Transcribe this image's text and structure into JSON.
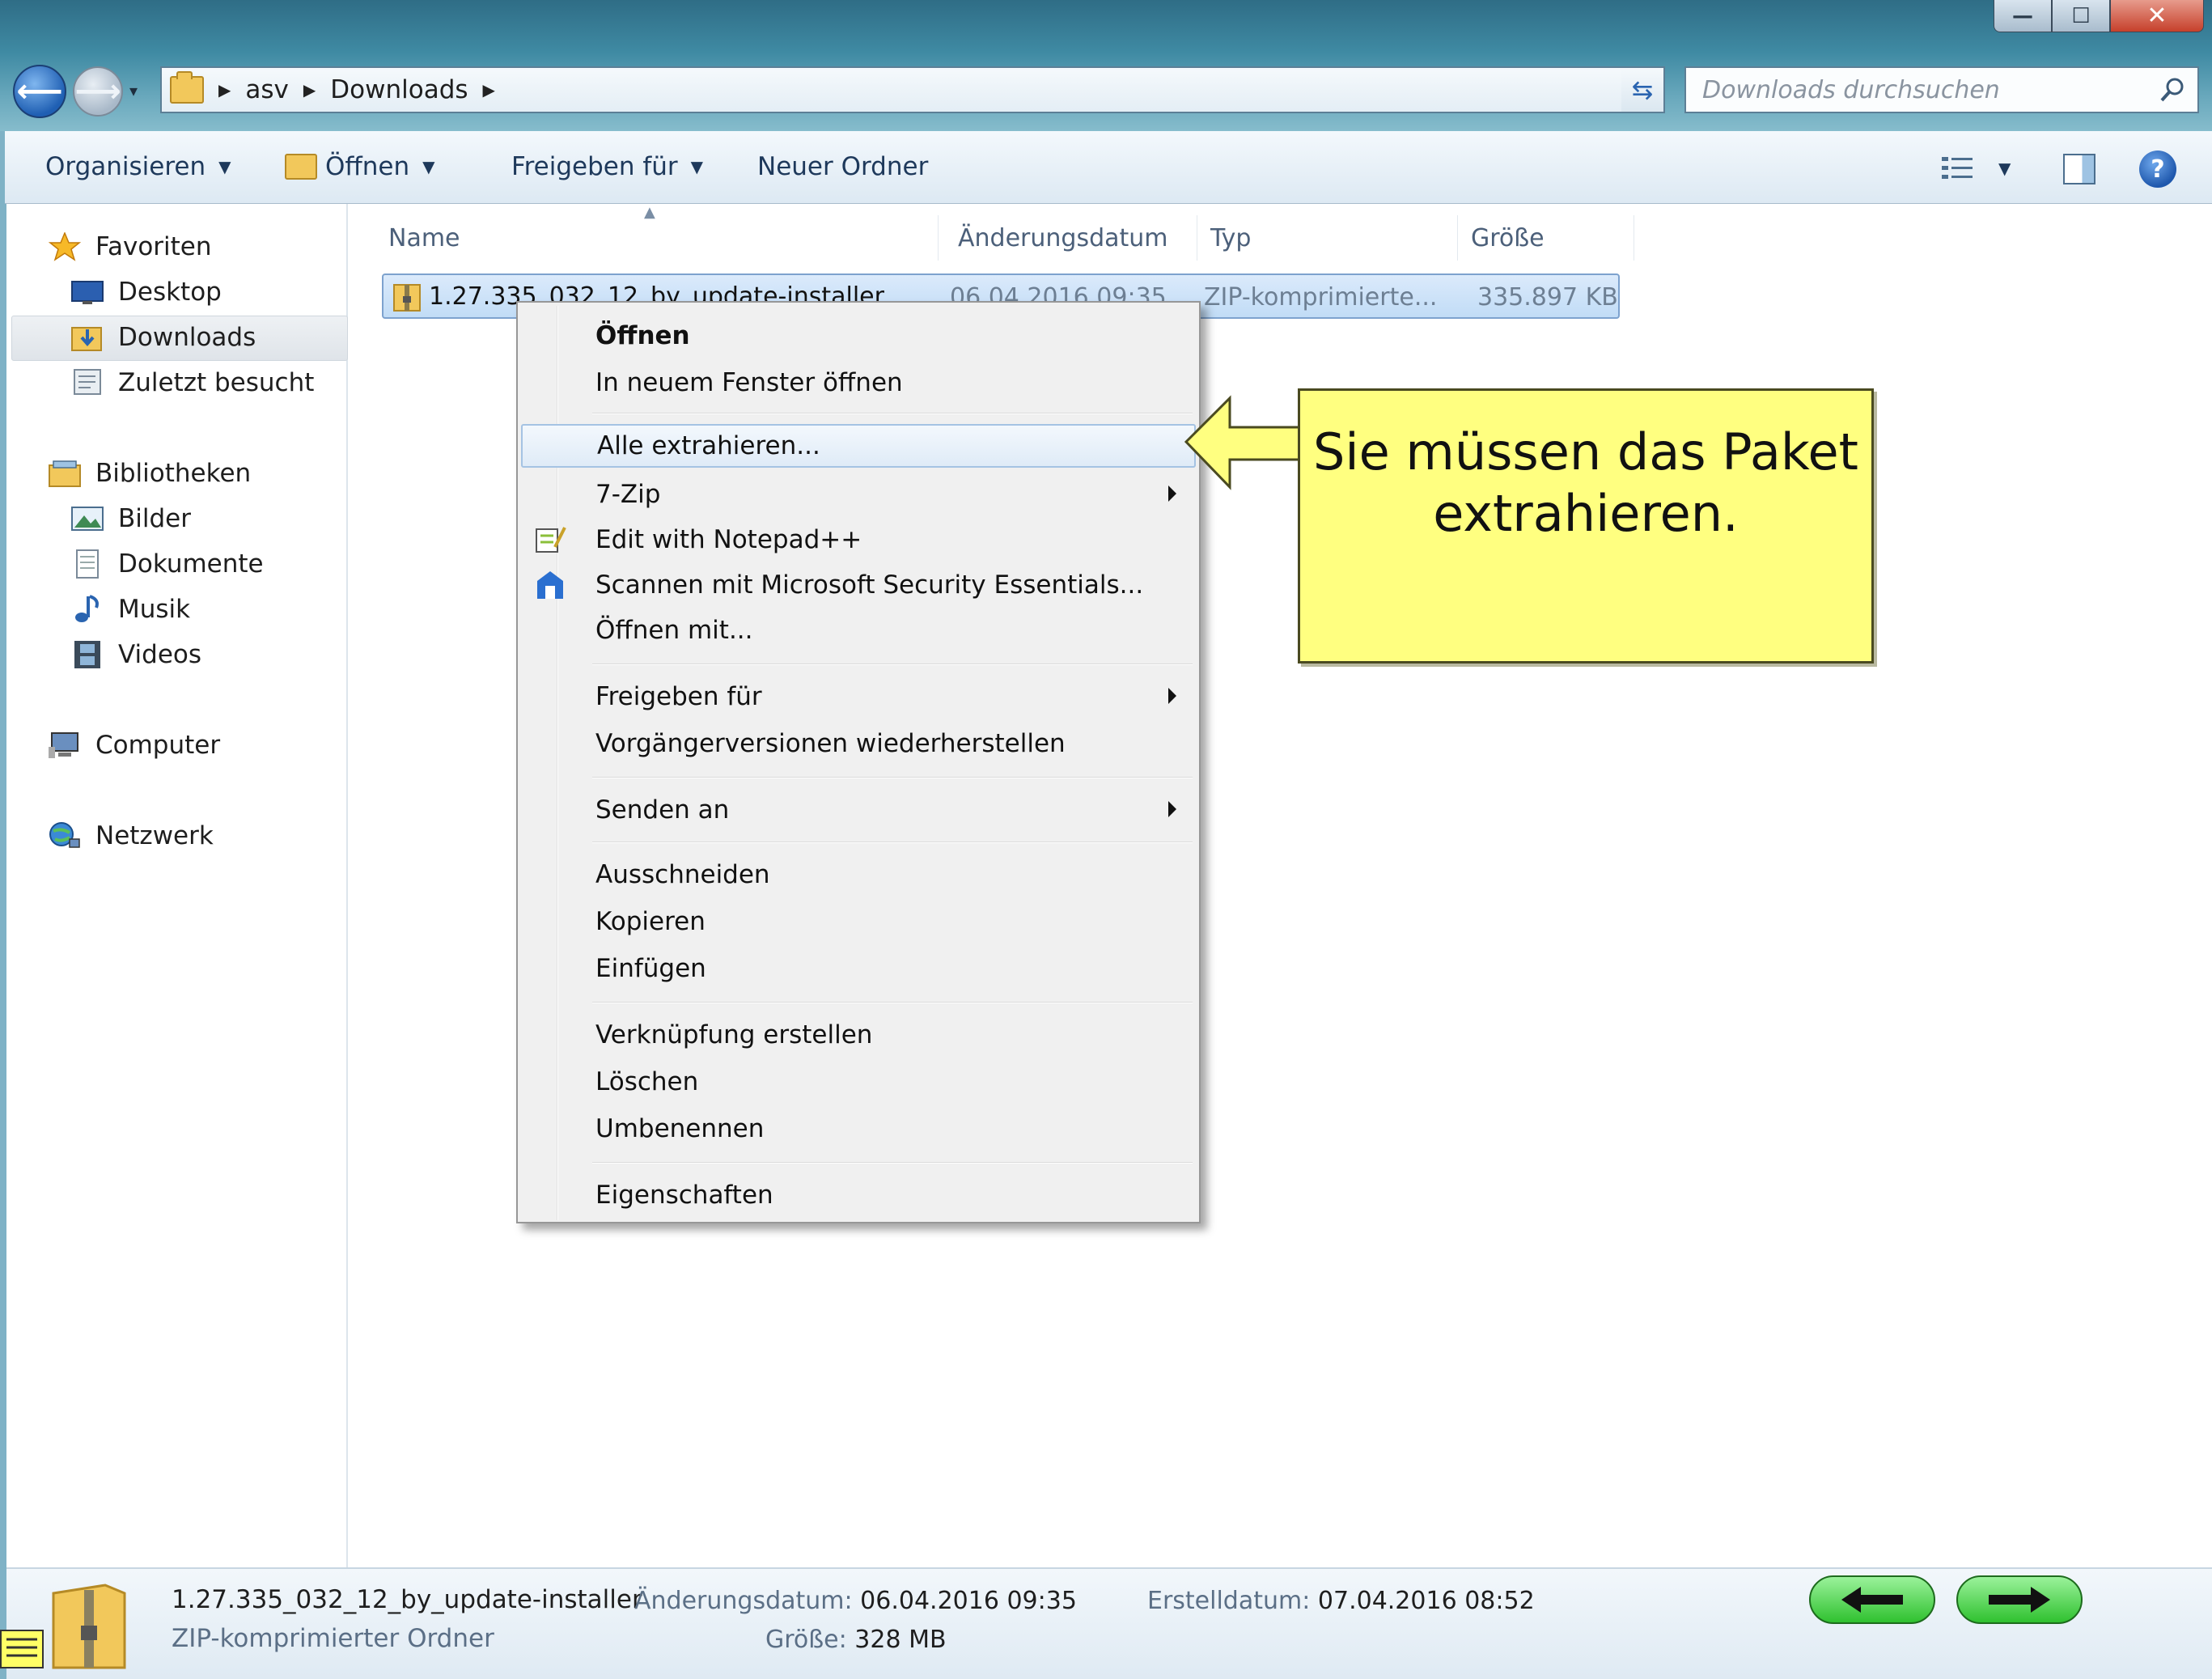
{
  "window": {
    "buttons": {
      "minimize": "—",
      "maximize": "☐",
      "close": "✕"
    }
  },
  "address": {
    "crumbs": [
      "asv",
      "Downloads"
    ],
    "search_placeholder": "Downloads durchsuchen"
  },
  "toolbar": {
    "organize": "Organisieren",
    "open": "Öffnen",
    "share": "Freigeben für",
    "new_folder": "Neuer Ordner",
    "help": "?"
  },
  "nav": {
    "favorites": "Favoriten",
    "desktop": "Desktop",
    "downloads": "Downloads",
    "recent": "Zuletzt besucht",
    "libraries": "Bibliotheken",
    "pictures": "Bilder",
    "documents": "Dokumente",
    "music": "Musik",
    "videos": "Videos",
    "computer": "Computer",
    "network": "Netzwerk"
  },
  "columns": {
    "name": "Name",
    "modified": "Änderungsdatum",
    "type": "Typ",
    "size": "Größe"
  },
  "file": {
    "name": "1.27.335_032_12_by_update-installer",
    "modified": "06.04.2016 09:35",
    "type": "ZIP-komprimierte...",
    "size": "335.897 KB"
  },
  "context_menu": {
    "open": "Öffnen",
    "open_new_window": "In neuem Fenster öffnen",
    "extract_all": "Alle extrahieren...",
    "seven_zip": "7-Zip",
    "edit_notepad": "Edit with Notepad++",
    "scan_mse": "Scannen mit Microsoft Security Essentials...",
    "open_with": "Öffnen mit...",
    "share": "Freigeben für",
    "restore_versions": "Vorgängerversionen wiederherstellen",
    "send_to": "Senden an",
    "cut": "Ausschneiden",
    "copy": "Kopieren",
    "paste": "Einfügen",
    "create_shortcut": "Verknüpfung erstellen",
    "delete": "Löschen",
    "rename": "Umbenennen",
    "properties": "Eigenschaften"
  },
  "callout": {
    "line1": "Sie müssen das Paket",
    "line2": "extrahieren."
  },
  "details": {
    "name": "1.27.335_032_12_by_update-installer",
    "kind": "ZIP-komprimierter Ordner",
    "modified_label": "Änderungsdatum:",
    "modified_value": "06.04.2016 09:35",
    "size_label": "Größe:",
    "size_value": "328 MB",
    "created_label": "Erstelldatum:",
    "created_value": "07.04.2016 08:52"
  },
  "colors": {
    "accent": "#1f5fb3",
    "callout_fill": "#ffff80",
    "nav_button_green": "#2fc12f"
  }
}
